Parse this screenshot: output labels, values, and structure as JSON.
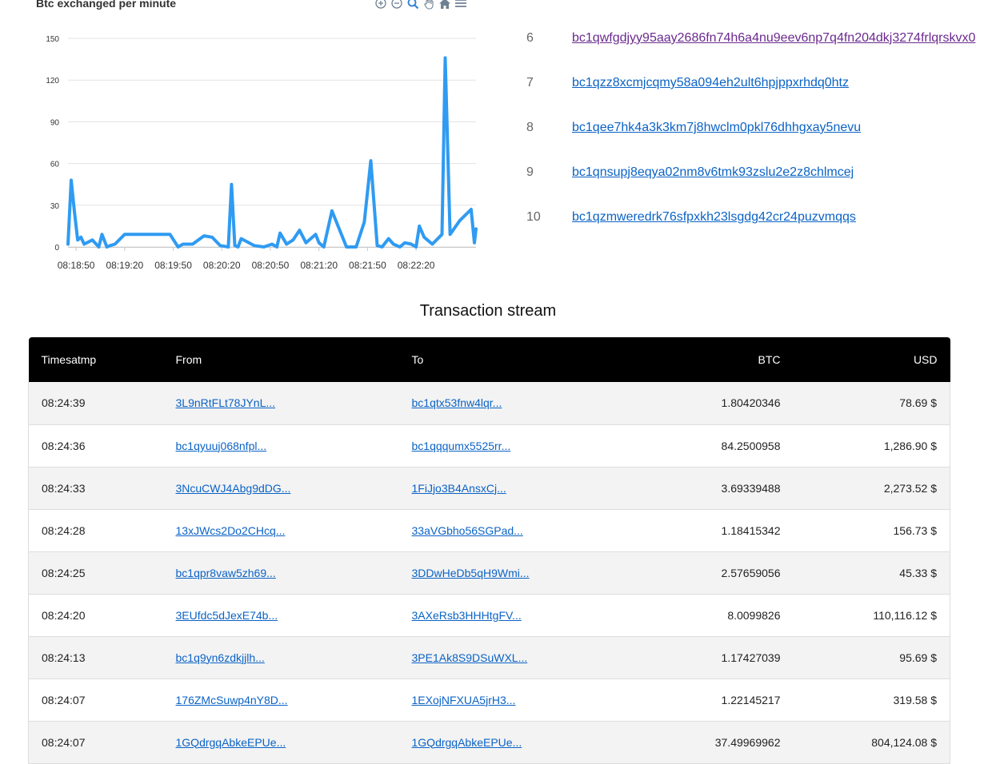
{
  "chart": {
    "title": "Btc exchanged per minute",
    "toolbar": [
      "zoom-in-icon",
      "zoom-out-icon",
      "magnifier-icon",
      "pan-hand-icon",
      "home-icon",
      "menu-icon"
    ]
  },
  "chart_data": {
    "type": "line",
    "title": "Btc exchanged per minute",
    "xlabel": "",
    "ylabel": "",
    "ylim": [
      0,
      150
    ],
    "yticks": [
      "0",
      "30",
      "60",
      "90",
      "120",
      "150"
    ],
    "xticks": [
      "08:18:50",
      "08:19:20",
      "08:19:50",
      "08:20:20",
      "08:20:50",
      "08:21:20",
      "08:21:50",
      "08:22:20"
    ],
    "xlim": [
      "08:18:45",
      "08:22:57"
    ],
    "grid": true,
    "color": "#2f9bf2",
    "series": [
      {
        "x": [
          "08:18:45",
          "08:18:47",
          "08:18:49",
          "08:18:51",
          "08:18:53",
          "08:18:55",
          "08:19:00",
          "08:19:04",
          "08:19:06",
          "08:19:09",
          "08:19:11",
          "08:19:14",
          "08:19:20",
          "08:19:22",
          "08:19:40",
          "08:19:43",
          "08:19:48",
          "08:19:53",
          "08:19:56",
          "08:20:02",
          "08:20:09",
          "08:20:14",
          "08:20:19",
          "08:20:24",
          "08:20:26",
          "08:20:28",
          "08:20:30",
          "08:20:32",
          "08:20:40",
          "08:20:46",
          "08:20:51",
          "08:20:54",
          "08:20:56",
          "08:21:00",
          "08:21:04",
          "08:21:08",
          "08:21:12",
          "08:21:18",
          "08:21:20",
          "08:21:23",
          "08:21:28",
          "08:21:37",
          "08:21:43",
          "08:21:48",
          "08:21:52",
          "08:21:56",
          "08:21:59",
          "08:22:03",
          "08:22:06",
          "08:22:10",
          "08:22:13",
          "08:22:17",
          "08:22:20",
          "08:22:22",
          "08:22:25",
          "08:22:30",
          "08:22:36",
          "08:22:38",
          "08:22:41",
          "08:22:47",
          "08:22:54",
          "08:22:56",
          "08:22:57"
        ],
        "y": [
          2,
          48,
          25,
          5,
          7,
          2,
          5,
          0,
          9,
          0,
          1,
          2,
          9,
          9,
          9,
          9,
          9,
          0,
          2,
          2,
          8,
          7,
          1,
          0,
          45,
          1,
          0,
          6,
          1,
          0,
          2,
          0,
          10,
          2,
          5,
          12,
          3,
          9,
          3,
          0,
          26,
          0,
          0,
          18,
          62,
          1,
          0,
          6,
          2,
          0,
          3,
          2,
          0,
          15,
          7,
          2,
          9,
          136,
          9,
          19,
          27,
          3,
          13
        ]
      }
    ]
  },
  "rankings": [
    {
      "rank": "6",
      "address": "bc1qwfgdjyy95aay2686fn74h6a4nu9eev6np7q4fn204dkj3274frlqrskvx0",
      "visited": true
    },
    {
      "rank": "7",
      "address": "bc1qzz8xcmjcqmy58a094eh2ult6hpjppxrhdq0htz",
      "visited": false
    },
    {
      "rank": "8",
      "address": "bc1qee7hk4a3k3km7j8hwclm0pkl76dhhgxay5nevu",
      "visited": false
    },
    {
      "rank": "9",
      "address": "bc1qnsupj8eqya02nm8v6tmk93zslu2e2z8chlmcej",
      "visited": false
    },
    {
      "rank": "10",
      "address": "bc1qzmweredrk76sfpxkh23lsgdg42cr24puzvmqqs",
      "visited": false
    }
  ],
  "stream": {
    "title": "Transaction stream",
    "columns": [
      "Timesatmp",
      "From",
      "To",
      "BTC",
      "USD"
    ],
    "rows": [
      {
        "time": "08:24:39",
        "from": "3L9nRtFLt78JYnL...",
        "to": "bc1qtx53fnw4lqr...",
        "btc": "1.80420346",
        "usd": "78.69 $"
      },
      {
        "time": "08:24:36",
        "from": "bc1qyuuj068nfpl...",
        "to": "bc1qqqumx5525rr...",
        "btc": "84.2500958",
        "usd": "1,286.90 $"
      },
      {
        "time": "08:24:33",
        "from": "3NcuCWJ4Abg9dDG...",
        "to": "1FiJjo3B4AnsxCj...",
        "btc": "3.69339488",
        "usd": "2,273.52 $"
      },
      {
        "time": "08:24:28",
        "from": "13xJWcs2Do2CHcq...",
        "to": "33aVGbho56SGPad...",
        "btc": "1.18415342",
        "usd": "156.73 $"
      },
      {
        "time": "08:24:25",
        "from": "bc1qpr8vaw5zh69...",
        "to": "3DDwHeDb5qH9Wmi...",
        "btc": "2.57659056",
        "usd": "45.33 $"
      },
      {
        "time": "08:24:20",
        "from": "3EUfdc5dJexE74b...",
        "to": "3AXeRsb3HHHtgFV...",
        "btc": "8.0099826",
        "usd": "110,116.12 $"
      },
      {
        "time": "08:24:13",
        "from": "bc1q9yn6zdkjjlh...",
        "to": "3PE1Ak8S9DSuWXL...",
        "btc": "1.17427039",
        "usd": "95.69 $"
      },
      {
        "time": "08:24:07",
        "from": "176ZMcSuwp4nY8D...",
        "to": "1EXojNFXUA5jrH3...",
        "btc": "1.22145217",
        "usd": "319.58 $"
      },
      {
        "time": "08:24:07",
        "from": "1GQdrgqAbkeEPUe...",
        "to": "1GQdrgqAbkeEPUe...",
        "btc": "37.49969962",
        "usd": "804,124.08 $"
      }
    ]
  }
}
